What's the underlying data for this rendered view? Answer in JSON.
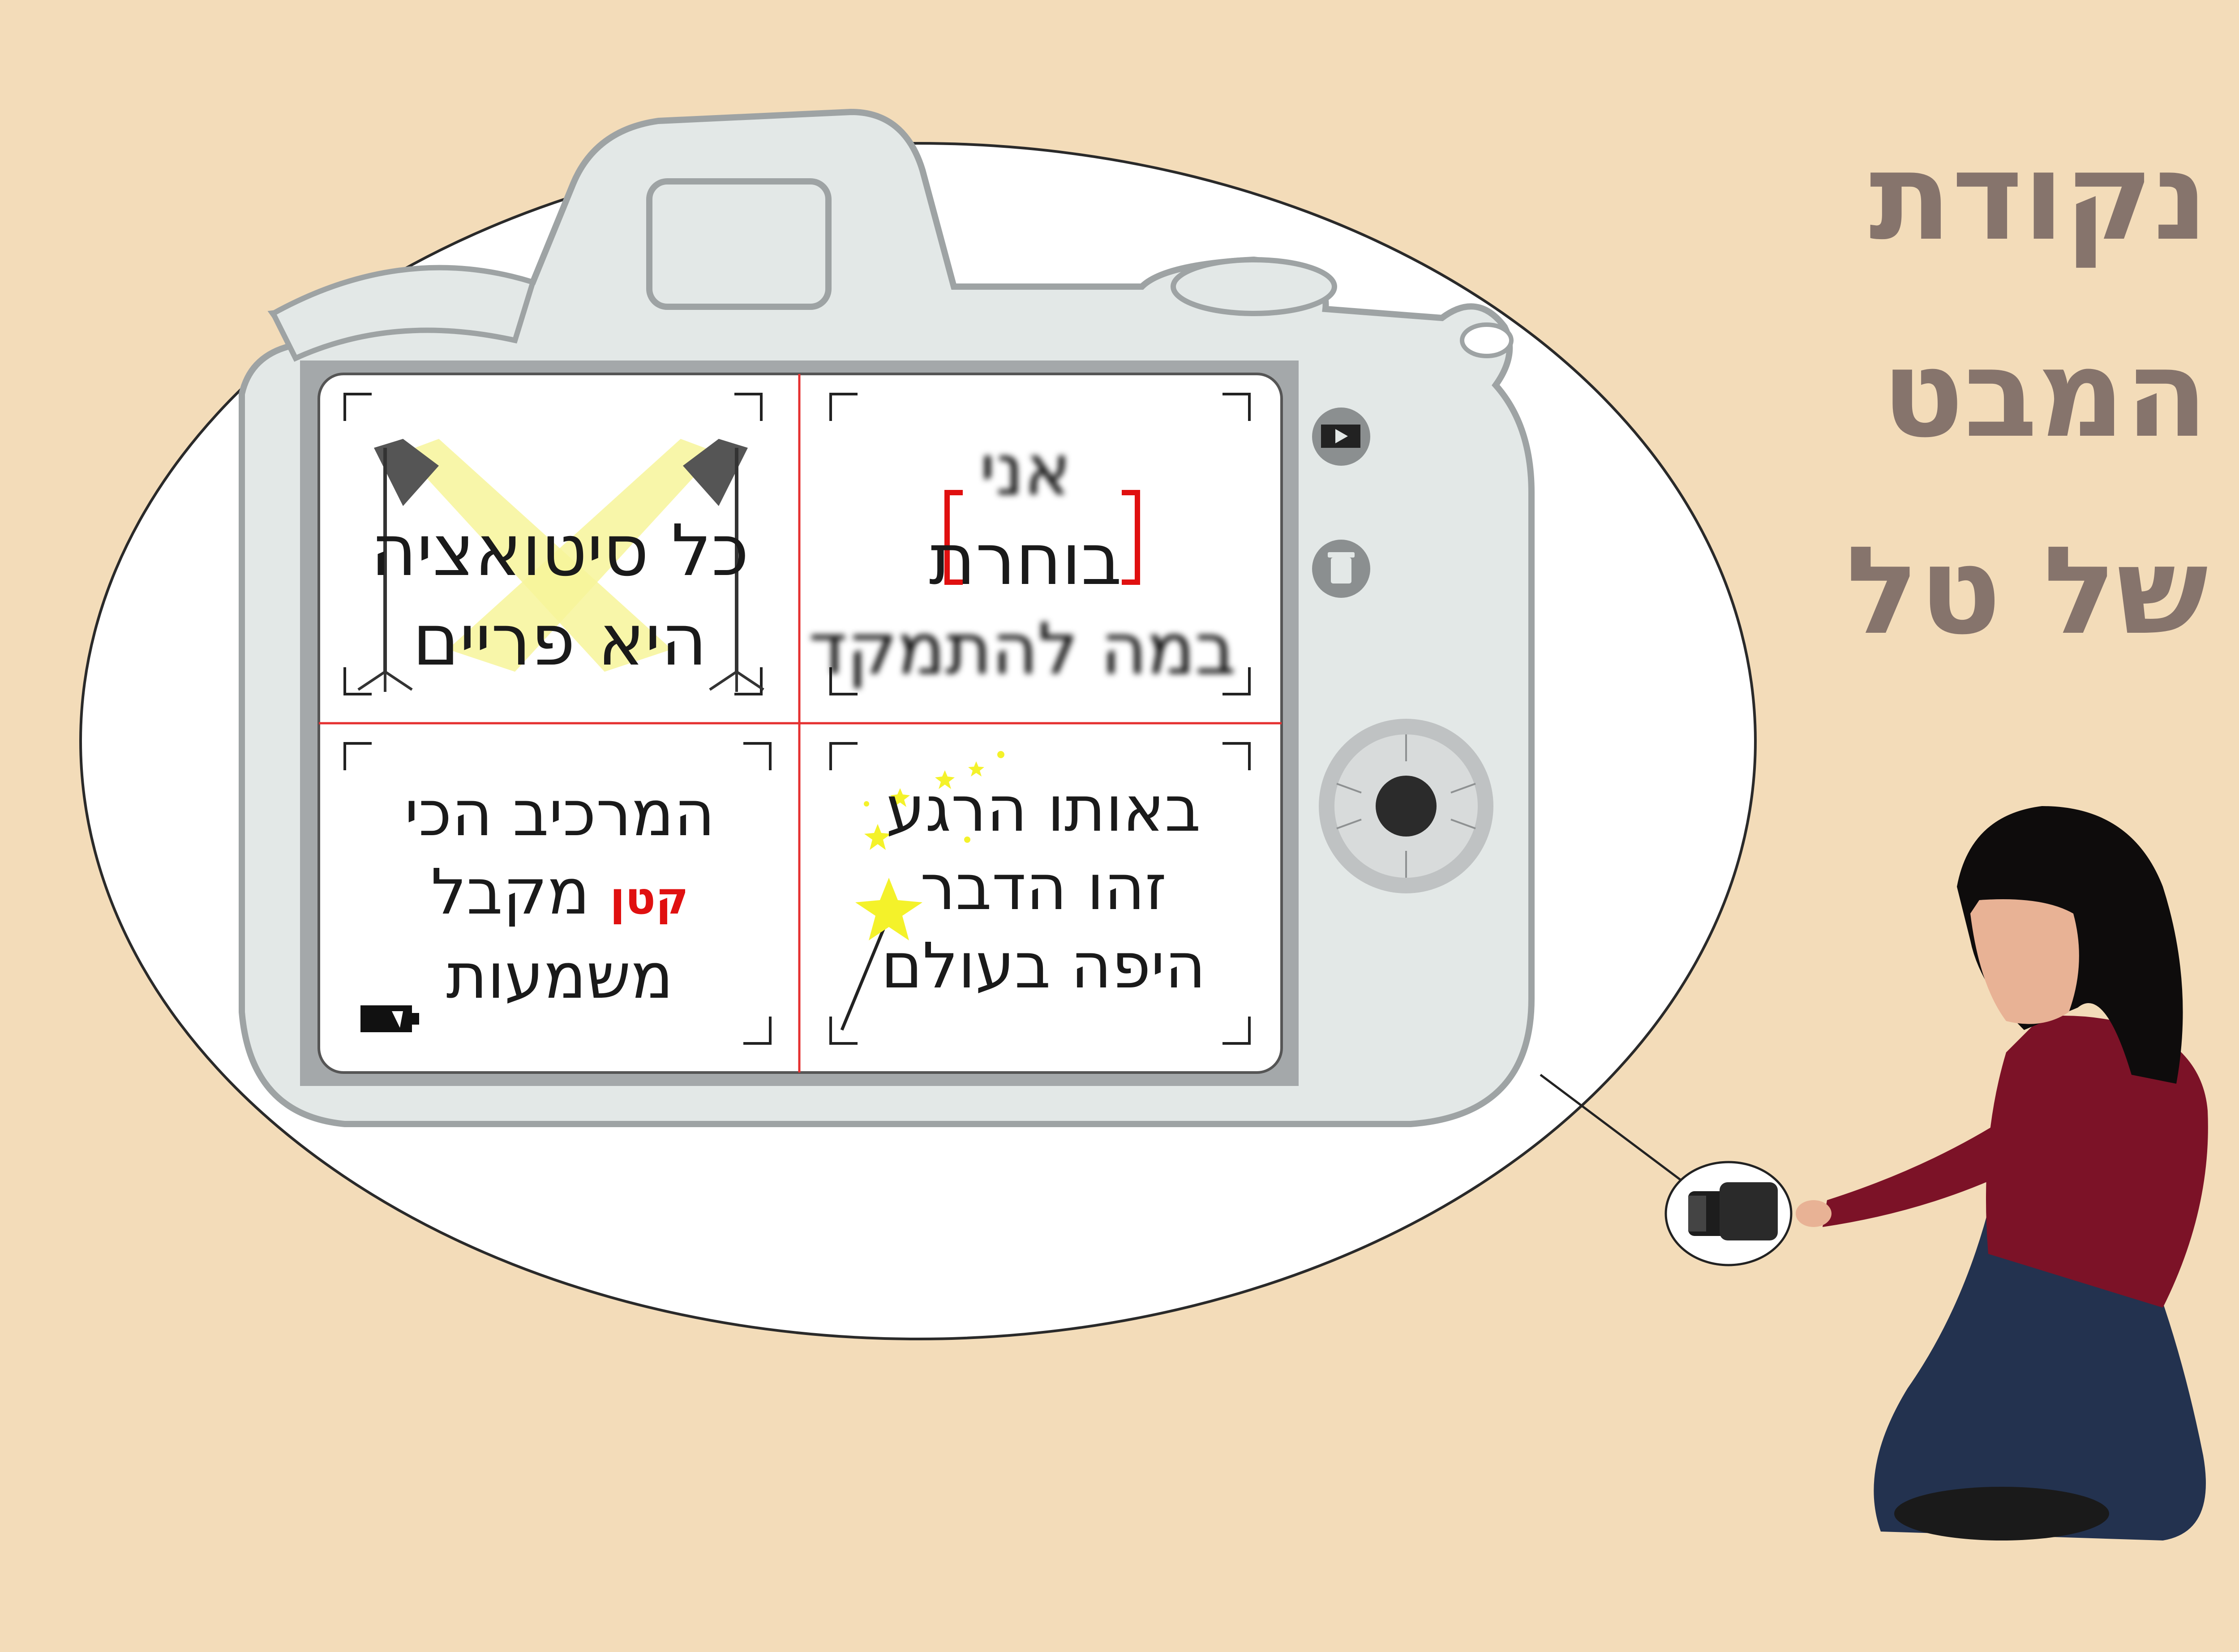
{
  "title": {
    "line1": "נקודת",
    "line2": "המבט",
    "line3": "של טל"
  },
  "camera": {
    "buttons": [
      "play-button",
      "trash-button",
      "navigation-dial"
    ],
    "screen": {
      "top_right": {
        "line1": "אני",
        "line2": "בוחרת",
        "line3": "במה להתמקד"
      },
      "top_left": {
        "line1": "כל סיטואציה",
        "line2": "היא פריים"
      },
      "bottom_right": {
        "line1": "באותו הרגע",
        "line2": "זהו הדבר",
        "line3": "היפה בעולם"
      },
      "bottom_left": {
        "line1": "המרכיב הכי",
        "line2_red": "קטן",
        "line2_rest": " מקבל",
        "line3": "משמעות"
      }
    }
  },
  "colors": {
    "background": "#f3dcb9",
    "title": "#86746c",
    "camera_body": "#e3e8e7",
    "accent_red": "#e01010",
    "light_beam": "#f7f49a"
  }
}
